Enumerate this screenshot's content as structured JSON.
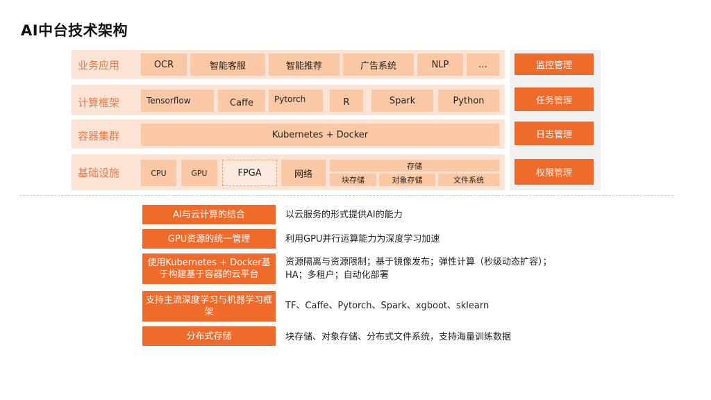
{
  "title": "AI中台技术架构",
  "layers": [
    {
      "label": "业务应用",
      "cells": [
        "OCR",
        "智能客服",
        "智能推荐",
        "广告系统",
        "NLP",
        "..."
      ]
    },
    {
      "label": "计算框架",
      "cells": [
        "Tensorflow",
        "Caffe",
        "Pytorch",
        "R",
        "Spark",
        "Python"
      ]
    },
    {
      "label": "容器集群",
      "cells": [
        "Kubernetes + Docker"
      ]
    },
    {
      "label": "基础设施",
      "cells": [
        "CPU",
        "GPU",
        "FPGA",
        "网络"
      ],
      "storage": {
        "label": "存储",
        "items": [
          "块存储",
          "对象存储",
          "文件系统"
        ]
      }
    }
  ],
  "side_panel": [
    "监控管理",
    "任务管理",
    "日志管理",
    "权限管理"
  ],
  "features": [
    {
      "name": "AI与云计算的结合",
      "desc": "以云服务的形式提供AI的能力"
    },
    {
      "name": "GPU资源的统一管理",
      "desc": "利用GPU并行运算能力为深度学习加速"
    },
    {
      "name": "使用Kubernetes + Docker基于构建基于容器的云平台",
      "desc": "资源隔离与资源限制；基于镜像发布；弹性计算（秒级动态扩容）；HA；多租户；自动化部署"
    },
    {
      "name": "支持主流深度学习与机器学习框架",
      "desc": "TF、Caffe、Pytorch、Spark、xgboot、sklearn"
    },
    {
      "name": "分布式存储",
      "desc": "块存储、对象存储、分布式文件系统，支持海量训练数据"
    }
  ],
  "colors": {
    "accent": "#f06a2a",
    "cell": "#fac8a4",
    "row_bg": "#fbe3d6",
    "label": "#e87a48",
    "side_bg": "#f1f1f1"
  }
}
